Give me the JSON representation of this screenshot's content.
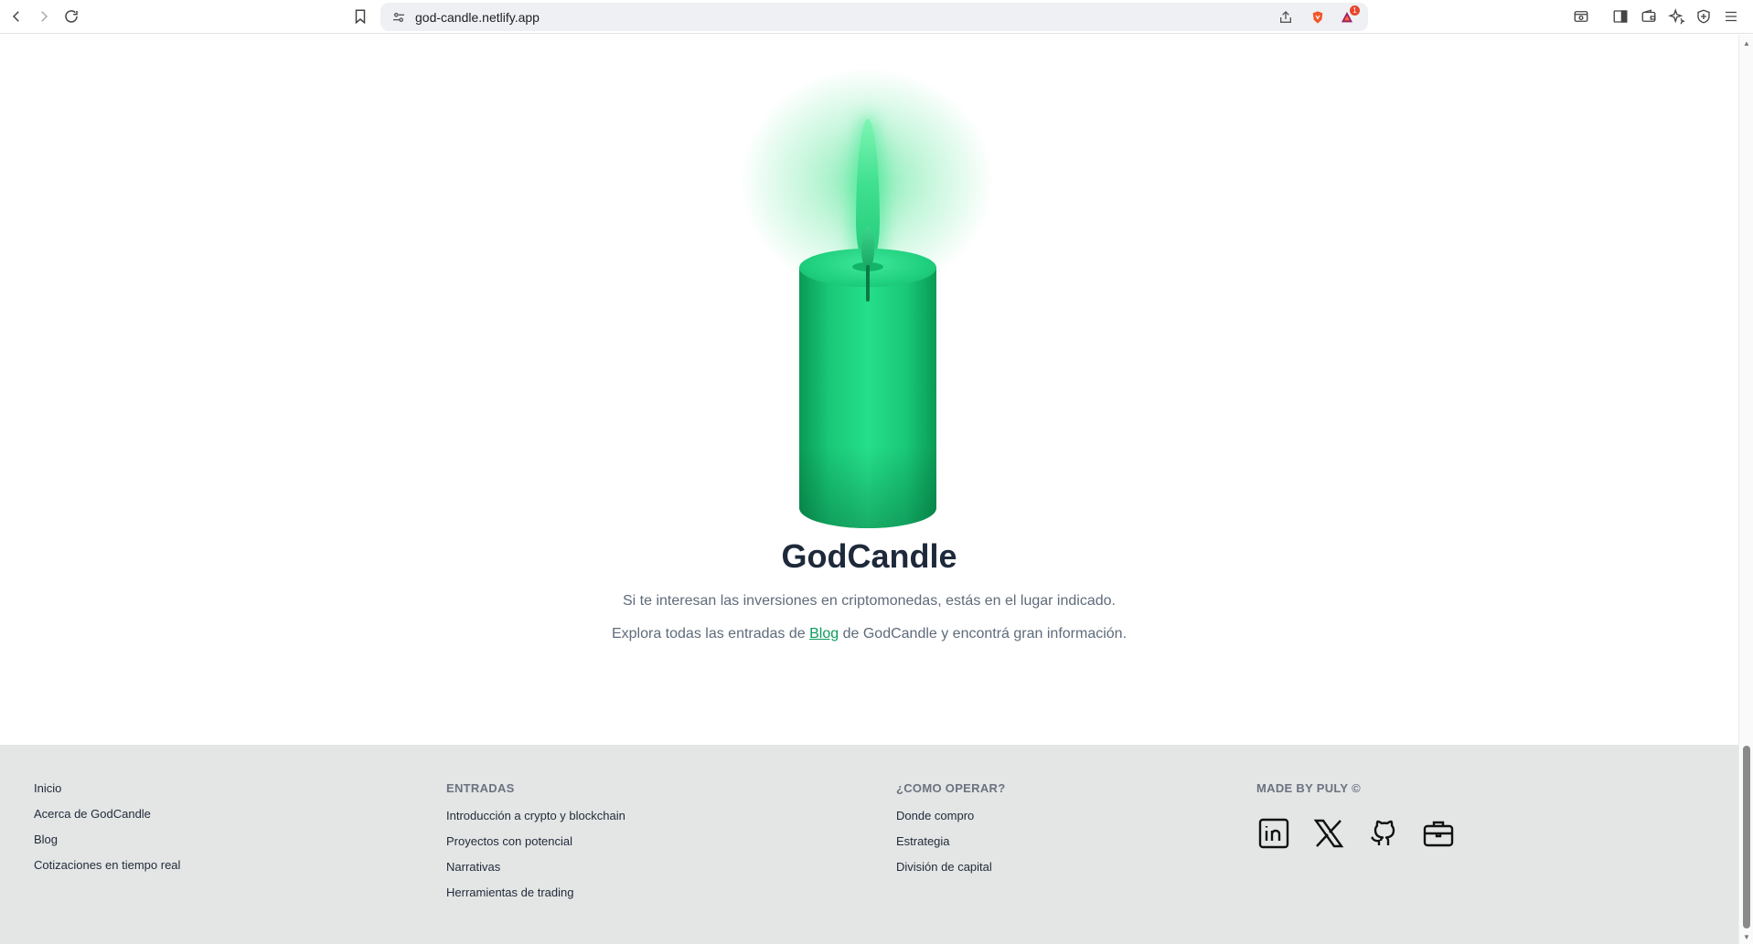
{
  "browser": {
    "url": "god-candle.netlify.app",
    "shield_badge": "1"
  },
  "hero": {
    "title": "GodCandle",
    "line1": "Si te interesan las inversiones en criptomonedas, estás en el lugar indicado.",
    "line2_before": "Explora todas las entradas de ",
    "line2_link": "Blog",
    "line2_after": " de GodCandle y encontrá gran información."
  },
  "footer": {
    "nav": {
      "items": [
        "Inicio",
        "Acerca de GodCandle",
        "Blog",
        "Cotizaciones en tiempo real"
      ]
    },
    "entradas": {
      "heading": "ENTRADAS",
      "items": [
        "Introducción a crypto y blockchain",
        "Proyectos con potencial",
        "Narrativas",
        "Herramientas de trading"
      ]
    },
    "operar": {
      "heading": "¿COMO OPERAR?",
      "items": [
        "Donde compro",
        "Estrategia",
        "División de capital"
      ]
    },
    "made_by": {
      "heading": "MADE BY PULY ©",
      "socials": [
        "linkedin-icon",
        "x-icon",
        "github-icon",
        "briefcase-icon"
      ]
    }
  },
  "colors": {
    "accent": "#0d9a5b",
    "candle": "#25df8a",
    "footer_bg": "#e4e6e6"
  }
}
